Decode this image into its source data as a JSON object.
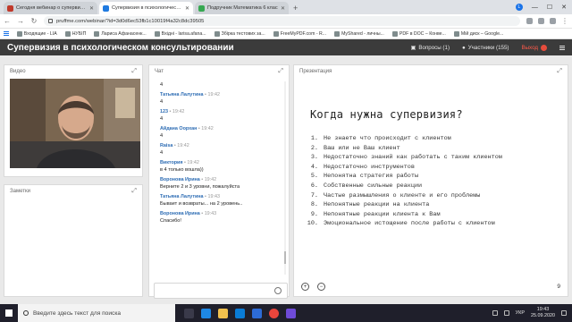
{
  "browser": {
    "tabs": [
      {
        "title": "Сегодня вебинар о супервизии",
        "active": false,
        "favicon": "red"
      },
      {
        "title": "Супервизия в психологическом",
        "active": true,
        "favicon": "blue"
      },
      {
        "title": "Подручник Математика 6 клас",
        "active": false,
        "favicon": "green"
      }
    ],
    "url": "pruffme.com/webinar/?id=3d0d6ec53fb1c10019f4a32c8dc39505",
    "profile_letter": "L",
    "bookmarks": [
      "Входящие - LIA",
      "НУБІП",
      "Лариса Афанасенк...",
      "Вхідні - larisa.afana...",
      "Збірка тестових за...",
      "FreeMyPDF.com - R...",
      "MyShared - личны...",
      "PDF в DOC – Конве...",
      "Мій диск – Google..."
    ]
  },
  "webinar": {
    "title": "Супервизия в психологическом консультировании",
    "questions_label": "Вопросы (1)",
    "participants_label": "Участники (155)",
    "exit_label": "Выход"
  },
  "video_panel": {
    "label": "Видео"
  },
  "notes_panel": {
    "label": "Заметки"
  },
  "chat_panel": {
    "label": "Чат",
    "messages": [
      {
        "author": "",
        "time": "",
        "text": "4"
      },
      {
        "author": "Татьяна Лалутина",
        "time": "19:42",
        "text": "4"
      },
      {
        "author": "123",
        "time": "19:42",
        "text": "4"
      },
      {
        "author": "Айдана Оорхан",
        "time": "19:42",
        "text": "4"
      },
      {
        "author": "Raisa",
        "time": "19:42",
        "text": "4"
      },
      {
        "author": "Виктория",
        "time": "19:42",
        "text": "в 4 только вошла))"
      },
      {
        "author": "Воронова Ирина",
        "time": "19:42",
        "text": "Верните 2 и 3 уровни, пожалуйста"
      },
      {
        "author": "Татьяна Лалутина",
        "time": "19:43",
        "text": "Бывает и возвраты... на 2 уровень.."
      },
      {
        "author": "Воронова Ирина",
        "time": "19:43",
        "text": "Спасибо!"
      }
    ]
  },
  "presentation": {
    "label": "Презентация",
    "slide_title": "Когда нужна супервизия?",
    "items": [
      "Не знаете что происходит с клиентом",
      "Ваш или не Ваш клиент",
      "Недостаточно знаний как работать с таким клиентом",
      "Недостаточно инструментов",
      "Непонятна стратегия работы",
      "Собственные сильные реакции",
      "Частые размышления о клиенте и его проблемы",
      "Непонятные реакции на клиента",
      "Непонятные реакции клиента к Вам",
      "Эмоциональное истощение после работы с клиентом"
    ],
    "page": "9"
  },
  "taskbar": {
    "search_placeholder": "Введите здесь текст для поиска",
    "language": "УКР",
    "time": "19:43",
    "date": "25.09.2020"
  }
}
